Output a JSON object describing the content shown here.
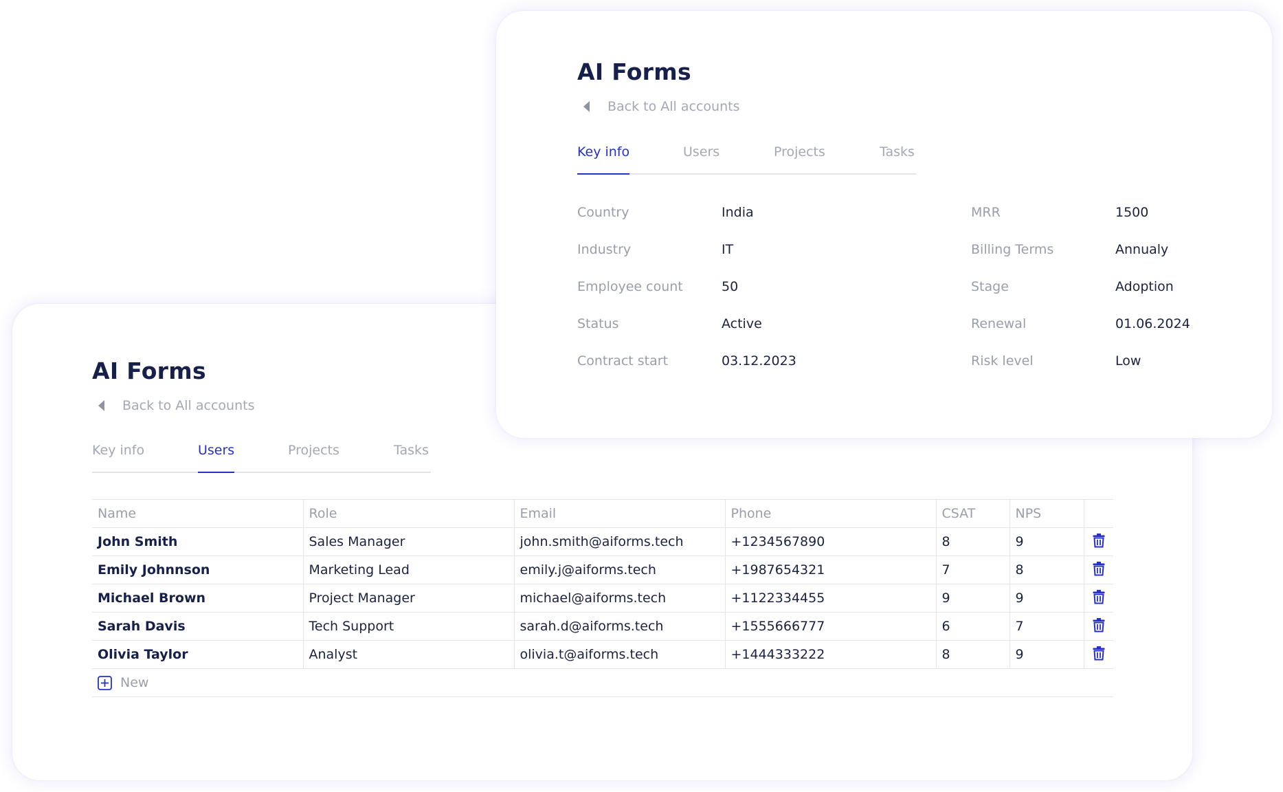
{
  "colors": {
    "accent": "#2530c8",
    "title": "#16204a",
    "muted": "#9a9dab",
    "border": "#e4e5ea"
  },
  "users_card": {
    "title": "AI Forms",
    "back_label": "Back to All accounts",
    "tabs": [
      {
        "label": "Key info",
        "active": false
      },
      {
        "label": "Users",
        "active": true
      },
      {
        "label": "Projects",
        "active": false
      },
      {
        "label": "Tasks",
        "active": false
      }
    ],
    "table": {
      "columns": [
        "Name",
        "Role",
        "Email",
        "Phone",
        "CSAT",
        "NPS"
      ],
      "rows": [
        {
          "name": "John Smith",
          "role": "Sales Manager",
          "email": "john.smith@aiforms.tech",
          "phone": "+1234567890",
          "csat": "8",
          "nps": "9"
        },
        {
          "name": "Emily Johnnson",
          "role": "Marketing Lead",
          "email": "emily.j@aiforms.tech",
          "phone": "+1987654321",
          "csat": "7",
          "nps": "8"
        },
        {
          "name": "Michael Brown",
          "role": "Project Manager",
          "email": "michael@aiforms.tech",
          "phone": "+1122334455",
          "csat": "9",
          "nps": "9"
        },
        {
          "name": "Sarah Davis",
          "role": "Tech Support",
          "email": "sarah.d@aiforms.tech",
          "phone": "+1555666777",
          "csat": "6",
          "nps": "7"
        },
        {
          "name": "Olivia Taylor",
          "role": "Analyst",
          "email": "olivia.t@aiforms.tech",
          "phone": "+1444333222",
          "csat": "8",
          "nps": "9"
        }
      ],
      "row_action_icon": "trash-icon"
    },
    "new_label": "New",
    "new_icon": "plus-square-icon"
  },
  "keyinfo_card": {
    "title": "AI Forms",
    "back_label": "Back to All accounts",
    "tabs": [
      {
        "label": "Key info",
        "active": true
      },
      {
        "label": "Users",
        "active": false
      },
      {
        "label": "Projects",
        "active": false
      },
      {
        "label": "Tasks",
        "active": false
      }
    ],
    "left_fields": [
      {
        "label": "Country",
        "value": "India"
      },
      {
        "label": "Industry",
        "value": "IT"
      },
      {
        "label": "Employee count",
        "value": "50"
      },
      {
        "label": "Status",
        "value": "Active"
      },
      {
        "label": "Contract start",
        "value": "03.12.2023"
      }
    ],
    "right_fields": [
      {
        "label": "MRR",
        "value": "1500"
      },
      {
        "label": "Billing Terms",
        "value": "Annualy"
      },
      {
        "label": "Stage",
        "value": "Adoption"
      },
      {
        "label": "Renewal",
        "value": "01.06.2024"
      },
      {
        "label": "Risk level",
        "value": "Low"
      }
    ]
  }
}
